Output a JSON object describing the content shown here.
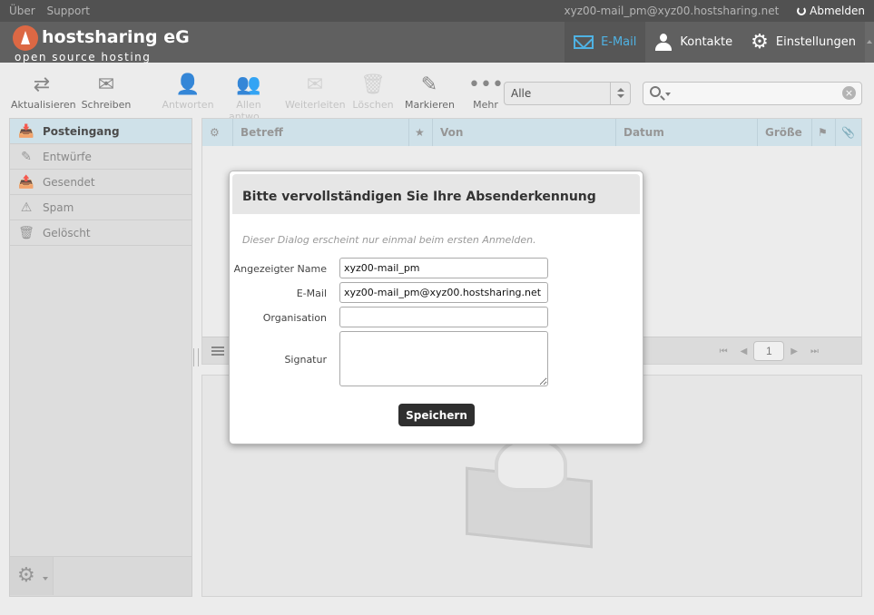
{
  "topline": {
    "links": [
      "Über",
      "Support"
    ],
    "user_email": "xyz00-mail_pm@xyz00.hostsharing.net",
    "logout_label": "Abmelden"
  },
  "header": {
    "brand": "hostsharing eG",
    "tagline": "open source hosting",
    "nav": [
      {
        "label": "E-Mail",
        "icon": "envelope-icon",
        "active": true
      },
      {
        "label": "Kontakte",
        "icon": "person-icon",
        "active": false
      },
      {
        "label": "Einstellungen",
        "icon": "gear-icon",
        "active": false
      }
    ]
  },
  "toolbar": {
    "refresh": "Aktualisieren",
    "compose": "Schreiben",
    "reply": "Antworten",
    "reply_all": "Allen antwo...",
    "forward": "Weiterleiten",
    "delete": "Löschen",
    "mark": "Markieren",
    "more": "Mehr",
    "filter_value": "Alle",
    "search_placeholder": ""
  },
  "folders": [
    {
      "label": "Posteingang",
      "icon": "inbox-icon",
      "active": true
    },
    {
      "label": "Entwürfe",
      "icon": "pencil-icon",
      "active": false
    },
    {
      "label": "Gesendet",
      "icon": "sent-icon",
      "active": false
    },
    {
      "label": "Spam",
      "icon": "spam-icon",
      "active": false
    },
    {
      "label": "Gelöscht",
      "icon": "trash-icon",
      "active": false
    }
  ],
  "message_list": {
    "columns": [
      "Betreff",
      "Von",
      "Datum",
      "Größe"
    ],
    "page": "1"
  },
  "dialog": {
    "title": "Bitte vervollständigen Sie Ihre Absenderkennung",
    "note": "Dieser Dialog erscheint nur einmal beim ersten Anmelden.",
    "fields": {
      "display_name_label": "Angezeigter Name",
      "display_name_value": "xyz00-mail_pm",
      "email_label": "E-Mail",
      "email_value": "xyz00-mail_pm@xyz00.hostsharing.net",
      "organisation_label": "Organisation",
      "organisation_value": "",
      "signature_label": "Signatur",
      "signature_value": ""
    },
    "save_label": "Speichern"
  }
}
